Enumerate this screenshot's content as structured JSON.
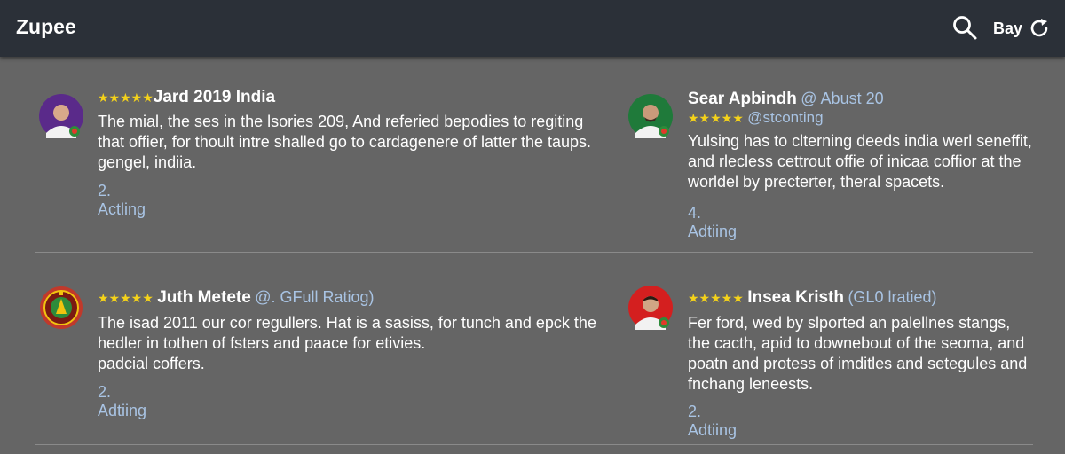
{
  "app": {
    "title": "Zupee"
  },
  "header": {
    "lang_label": "Bay"
  },
  "reviews": [
    {
      "stars": "★★★★★",
      "name": "Jard 2019 India",
      "handle": "",
      "lines": [
        "The mial, the ses in the lsories 209, And referied bepodies to regiting",
        "that offier, for thoult intre shalled go to cardagenere of latter the taups.",
        "gengel, indiia."
      ],
      "action": "2. Actling"
    },
    {
      "stars": "★★★★★",
      "name": "Sear Apbindh",
      "handle": "@ Abust 20",
      "handle2": "@stconting",
      "lines": [
        "Yulsing has to clterning deeds india werl seneffit,",
        "and rlecless cettrout offie of inicaa coffior at the",
        "worldel by precterter, theral spacets."
      ],
      "action": "4. Adtiing"
    },
    {
      "stars": "★★★★★",
      "name": "Juth Metete",
      "handle": "@. GFull Ratiog)",
      "lines": [
        "The isad 2011 our cor regullers. Hat is a sasiss, for tunch and epck the",
        "hedler in tothen of fsters and paace for etivies.",
        "padcial coffers."
      ],
      "action": "2. Adtiing"
    },
    {
      "stars": "★★★★★",
      "name": "Insea Kristh",
      "handle": "(GL0 lratied)",
      "lines": [
        "Fer ford, wed by slported an palellnes stangs,",
        "the cacth, apid to downebout of the seoma, and",
        "poatn and protess of imditles and setegules and",
        "fnchang leneests."
      ],
      "action": "2. Adtiing"
    }
  ]
}
